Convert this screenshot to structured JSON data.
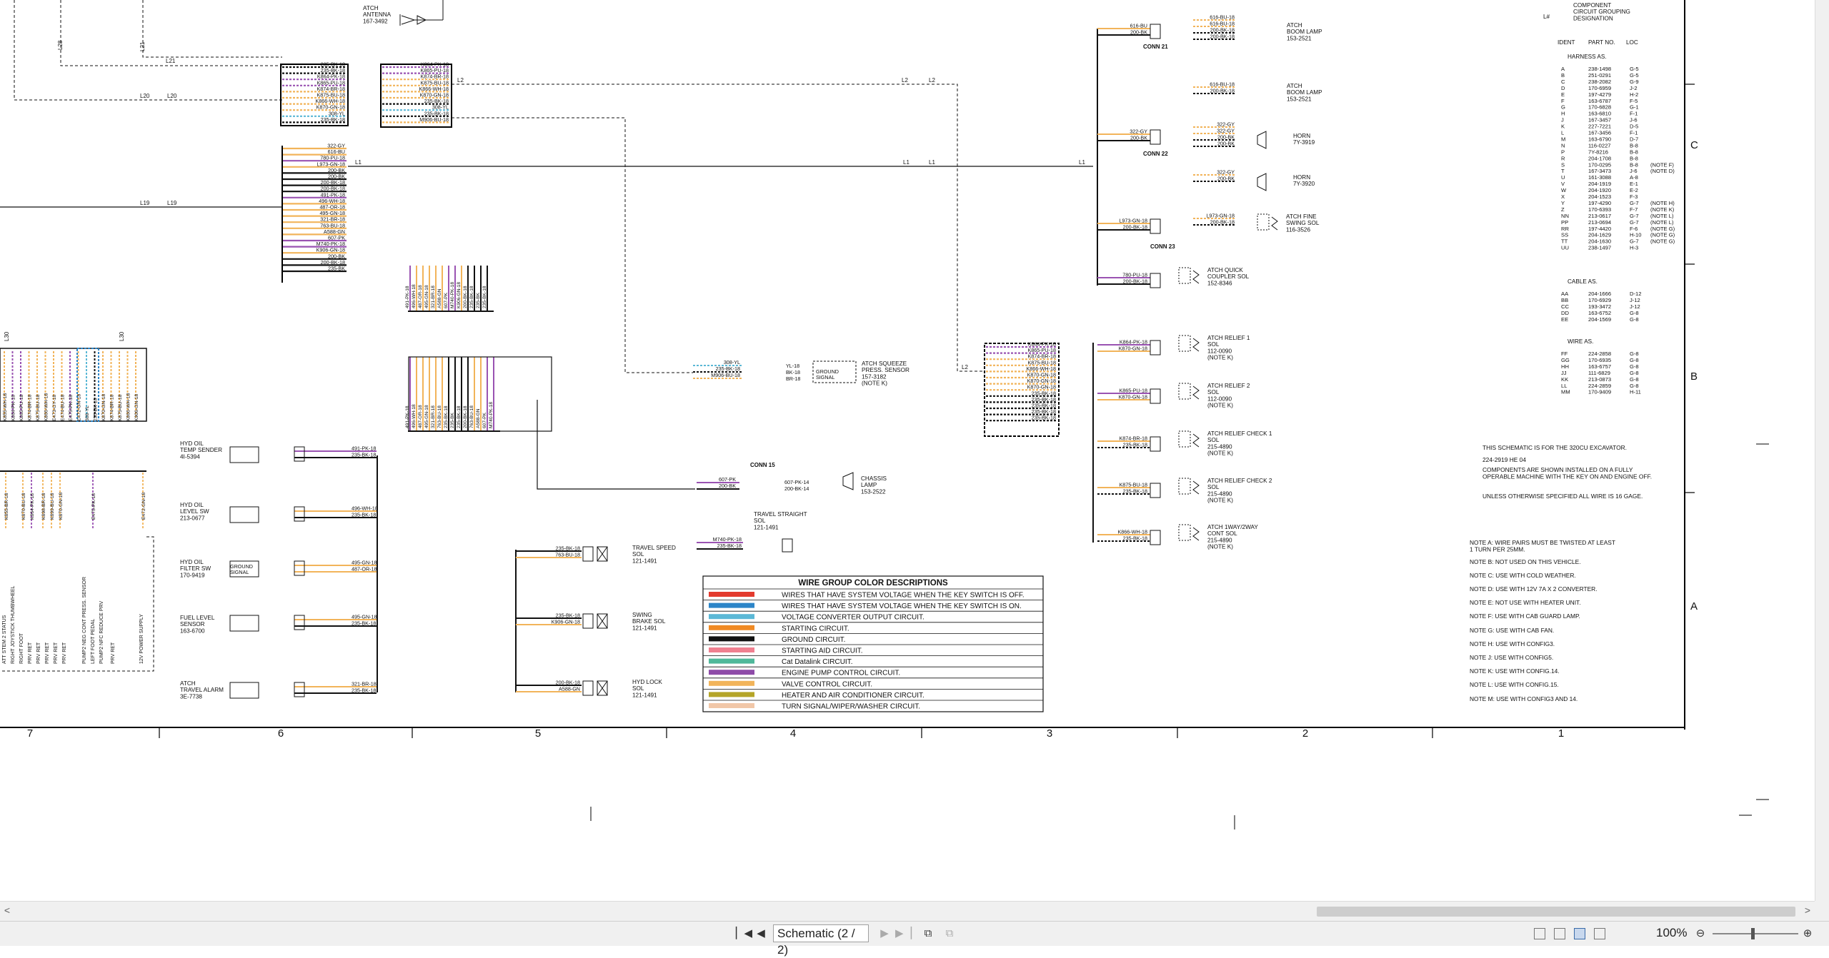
{
  "grid": {
    "cols": [
      "7",
      "6",
      "5",
      "4",
      "3",
      "2",
      "1"
    ],
    "rows": [
      "C",
      "B",
      "A"
    ]
  },
  "labels": {
    "antenna": "ATCH\nANTENNA\n167-3492",
    "conn21": "CONN 21",
    "conn22": "CONN 22",
    "conn23": "CONN 23",
    "conn15": "CONN 15",
    "boom_lamp": "ATCH\nBOOM LAMP\n153-2521",
    "horn1": "HORN\n7Y-3919",
    "horn2": "HORN\n7Y-3920",
    "fine_swing": "ATCH FINE\nSWING SOL\n116-3526",
    "quick_coupler": "ATCH QUICK\nCOUPLER SOL\n152-8346",
    "relief1": "ATCH RELIEF 1\nSOL\n112-0090\n(NOTE K)",
    "relief2": "ATCH RELIEF 2\nSOL\n112-0090\n(NOTE K)",
    "check1": "ATCH RELIEF CHECK 1\nSOL\n215-4890\n(NOTE K)",
    "check2": "ATCH RELIEF CHECK 2\nSOL\n215-4890\n(NOTE K)",
    "oneway": "ATCH 1WAY/2WAY\nCONT SOL\n215-4890\n(NOTE K)",
    "squeeze": "ATCH SQUEEZE\nPRESS. SENSOR\n157-3182\n(NOTE K)",
    "chassis_lamp": "CHASSIS\nLAMP\n153-2522",
    "travel_straight": "TRAVEL STRAIGHT\nSOL\n121-1491",
    "travel_speed": "TRAVEL SPEED\nSOL\n121-1491",
    "swing_brake": "SWING\nBRAKE SOL\n121-1491",
    "hyd_lock": "HYD LOCK\nSOL\n121-1491",
    "hyd_temp": "HYD OIL\nTEMP SENDER\n4I-5394",
    "hyd_level": "HYD OIL\nLEVEL SW\n213-0677",
    "hyd_filter": "HYD OIL\nFILTER SW\n170-9419",
    "fuel_level": "FUEL LEVEL\nSENSOR\n163-6700",
    "travel_alarm": "ATCH\nTRAVEL ALARM\n3E-7738",
    "ground_signal": "GROUND\nSIGNAL",
    "component_grouping": "COMPONENT\nCIRCUIT GROUPING\nDESIGNATION",
    "l_hash": "L#"
  },
  "wires": {
    "left_top": [
      "235-BK-18",
      "235-BK-18",
      "K864-PK-18",
      "K865-PU-18",
      "K874-BR-18",
      "K875-BU-18",
      "K866-WH-18",
      "K870-GN-18",
      "308-YL",
      "235-BK-18"
    ],
    "mid_top": [
      "K864-PK-18",
      "K865-PU-18",
      "K874-BR-18",
      "K875-BU-18",
      "K866-WH-18",
      "K870-GN-18",
      "235-BK-18",
      "308-YL",
      "235-BK-18",
      "M906-BU-18"
    ],
    "left_mid": [
      "322-GY",
      "616-BU",
      "780-PU-18",
      "L973-GN-18",
      "200-BK",
      "200-BK",
      "200-BK-18",
      "200-BK-18",
      "491-PK-18",
      "496-WH-18",
      "487-OR-18",
      "495-GN-18",
      "321-BR-18",
      "763-BU-18",
      "A588-GN",
      "607-PK",
      "M740-PK-18",
      "K906-GN-18",
      "200-BK",
      "200-BK-18",
      "235-BK"
    ],
    "right_harness": [
      "K864-PK-18",
      "K865-PU-18",
      "K874-BR-18",
      "K875-BU-18",
      "K866-WH-18",
      "K870-GN-18",
      "K870-GN-18",
      "K870-GN-18",
      "235-BK-18",
      "235-BK-18",
      "235-BK-18",
      "235-BK-18",
      "235-BK-18"
    ],
    "left_bottom_vertical": [
      "ATT STEM 2 STATUS",
      "RIGHT JOYSTICK THUMBWHEEL",
      "RIGHT FOOT",
      "PRV RET",
      "PRV RET",
      "PRV RET",
      "PRV RET",
      "PRV RET",
      "PUMP2 NEG CONT PRESS. SENSOR",
      "LEFT FOOT PEDAL",
      "PUMP2 NFC REDUCE PRV",
      "PRV RET",
      "12V POWER SUPPLY"
    ],
    "left_upper_vertical": [
      "K855-WH-18",
      "K864-PK-18",
      "K865-PU-18",
      "K874-BR-18",
      "K875-BU-18",
      "K866-WH-18",
      "E473-GY-18",
      "E474-BU-18",
      "E475-PK-18",
      "E472-GN-18",
      "308-YL",
      "235-BK-18",
      "K870-GN-18",
      "K874-BR-18",
      "K875-BU-18",
      "K866-WH-18",
      "K906-GN-18"
    ]
  },
  "labels_l": {
    "l28": "L28",
    "l21": "L21",
    "l20": "L20",
    "l19": "L19",
    "l2": "L2",
    "l1": "L1",
    "l30": "L30"
  },
  "parts_table": {
    "headers": [
      "IDENT",
      "PART NO.",
      "LOC"
    ],
    "harness_title": "HARNESS AS.",
    "harness": [
      [
        "A",
        "238-1498",
        "G-5",
        ""
      ],
      [
        "B",
        "251-0291",
        "G-5",
        ""
      ],
      [
        "C",
        "238-2082",
        "G-9",
        ""
      ],
      [
        "D",
        "170-6959",
        "J-2",
        ""
      ],
      [
        "E",
        "197-4279",
        "H-2",
        ""
      ],
      [
        "F",
        "163-6787",
        "F-5",
        ""
      ],
      [
        "G",
        "170-6828",
        "G-1",
        ""
      ],
      [
        "H",
        "163-6810",
        "F-1",
        ""
      ],
      [
        "J",
        "167-3457",
        "J-6",
        ""
      ],
      [
        "K",
        "227-7221",
        "D-5",
        ""
      ],
      [
        "L",
        "167-3456",
        "F-1",
        ""
      ],
      [
        "M",
        "163-6790",
        "D-7",
        ""
      ],
      [
        "N",
        "116-0227",
        "B-8",
        ""
      ],
      [
        "P",
        "7Y-8216",
        "B-8",
        ""
      ],
      [
        "R",
        "204-1708",
        "B-8",
        ""
      ],
      [
        "S",
        "170-0295",
        "B-8",
        "(NOTE F)"
      ],
      [
        "T",
        "167-3473",
        "J-6",
        "(NOTE D)"
      ],
      [
        "U",
        "161-3088",
        "A-8",
        ""
      ],
      [
        "V",
        "204-1919",
        "E-1",
        ""
      ],
      [
        "W",
        "204-1920",
        "E-2",
        ""
      ],
      [
        "X",
        "204-1523",
        "F-3",
        ""
      ],
      [
        "Y",
        "197-4290",
        "G-7",
        "(NOTE H)"
      ],
      [
        "Z",
        "170-6393",
        "F-7",
        "(NOTE K)"
      ],
      [
        "NN",
        "213-0617",
        "G-7",
        "(NOTE L)"
      ],
      [
        "PP",
        "213-0694",
        "G-7",
        "(NOTE L)"
      ],
      [
        "RR",
        "197-4420",
        "F-6",
        "(NOTE G)"
      ],
      [
        "SS",
        "204-1629",
        "H-10",
        "(NOTE G)"
      ],
      [
        "TT",
        "204-1630",
        "G-7",
        "(NOTE G)"
      ],
      [
        "UU",
        "238-1497",
        "H-3",
        ""
      ]
    ],
    "cable_title": "CABLE AS.",
    "cable": [
      [
        "AA",
        "204-1666",
        "D-12",
        ""
      ],
      [
        "BB",
        "170-6929",
        "J-12",
        ""
      ],
      [
        "CC",
        "193-3472",
        "J-12",
        ""
      ],
      [
        "DD",
        "163-6752",
        "G-8",
        ""
      ],
      [
        "EE",
        "204-1569",
        "G-8",
        ""
      ]
    ],
    "wire_title": "WIRE AS.",
    "wire": [
      [
        "FF",
        "224-2858",
        "G-8",
        ""
      ],
      [
        "GG",
        "170-6935",
        "G-8",
        ""
      ],
      [
        "HH",
        "163-6757",
        "G-8",
        ""
      ],
      [
        "JJ",
        "111-6829",
        "G-8",
        ""
      ],
      [
        "KK",
        "213-0873",
        "G-8",
        ""
      ],
      [
        "LL",
        "224-2859",
        "G-8",
        ""
      ],
      [
        "MM",
        "170-9409",
        "H-11",
        ""
      ]
    ]
  },
  "info": {
    "schematic_for": "THIS SCHEMATIC IS FOR THE 320CU EXCAVATOR.",
    "doc_no": "224-2919 HE 04",
    "components_note": "COMPONENTS ARE SHOWN INSTALLED ON A FULLY\nOPERABLE MACHINE WITH THE KEY ON AND ENGINE OFF.",
    "wire_gauge": "UNLESS OTHERWISE SPECIFIED ALL WIRE IS 16 GAGE."
  },
  "notes": [
    "NOTE A: WIRE PAIRS MUST BE TWISTED AT LEAST\n        1 TURN PER 25MM.",
    "NOTE B: NOT USED ON THIS VEHICLE.",
    "NOTE C: USE WITH COLD WEATHER.",
    "NOTE D: USE WITH 12V 7A X 2 CONVERTER.",
    "NOTE E: NOT USE WITH HEATER UNIT.",
    "NOTE F: USE WITH CAB GUARD LAMP.",
    "NOTE G: USE WITH CAB FAN.",
    "NOTE H: USE WITH CONFIG3.",
    "NOTE J: USE WITH CONFIG5.",
    "NOTE K: USE WITH CONFIG.14.",
    "NOTE L: USE WITH CONFIG.15.",
    "NOTE M: USE WITH CONFIG3 AND 14."
  ],
  "legend": {
    "title": "WIRE GROUP COLOR DESCRIPTIONS",
    "items": [
      {
        "color": "#e33b2e",
        "label": "WIRES THAT HAVE SYSTEM VOLTAGE WHEN THE KEY SWITCH IS OFF."
      },
      {
        "color": "#2c85c8",
        "label": "WIRES THAT HAVE SYSTEM VOLTAGE WHEN THE KEY SWITCH IS ON."
      },
      {
        "color": "#5bb8d6",
        "label": "VOLTAGE CONVERTER OUTPUT CIRCUIT."
      },
      {
        "color": "#f08a24",
        "label": "STARTING CIRCUIT."
      },
      {
        "color": "#111111",
        "label": "GROUND CIRCUIT."
      },
      {
        "color": "#f08090",
        "label": "STARTING AID CIRCUIT."
      },
      {
        "color": "#4fb89a",
        "label": "Cat Datalink CIRCUIT."
      },
      {
        "color": "#8e4ba8",
        "label": "ENGINE PUMP CONTROL CIRCUIT."
      },
      {
        "color": "#f2b45a",
        "label": "VALVE CONTROL CIRCUIT."
      },
      {
        "color": "#b5a528",
        "label": "HEATER AND AIR CONDITIONER CIRCUIT."
      },
      {
        "color": "#f1c7a8",
        "label": "TURN SIGNAL/WIPER/WASHER CIRCUIT."
      }
    ]
  },
  "status_bar": {
    "page_select": "Schematic (2 / 2)",
    "zoom": "100%",
    "first_icon": "first-page-icon",
    "prev_icon": "previous-page-icon",
    "next_icon": "next-page-icon",
    "last_icon": "last-page-icon"
  },
  "scrollbars": {
    "left_arrow": "<",
    "right_arrow": ">"
  }
}
